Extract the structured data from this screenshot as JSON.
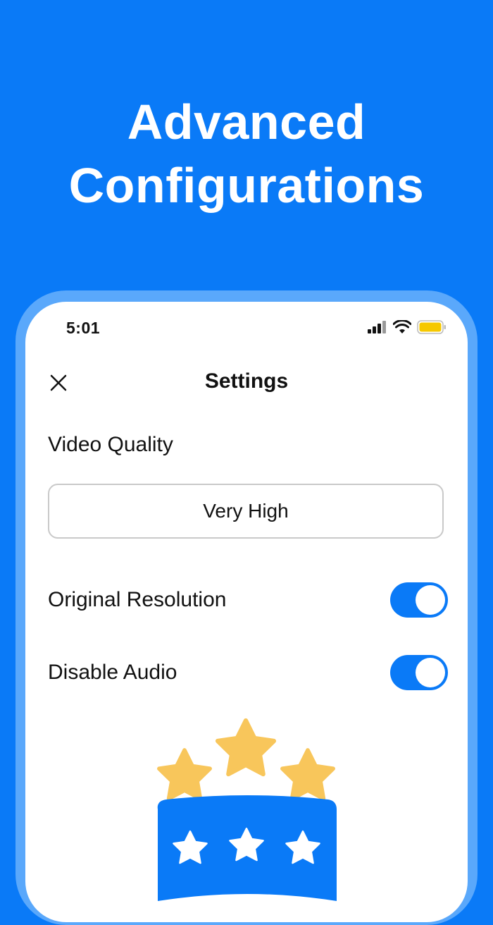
{
  "headline": {
    "line1": "Advanced",
    "line2": "Configurations"
  },
  "status_bar": {
    "time": "5:01",
    "icons": [
      "cellular-signal-icon",
      "wifi-icon",
      "battery-icon"
    ],
    "battery_color": "#f6c800"
  },
  "nav": {
    "close_icon": "close-icon",
    "title": "Settings"
  },
  "video_quality": {
    "label": "Video Quality",
    "selected": "Very High"
  },
  "settings": [
    {
      "label": "Original Resolution",
      "enabled": true
    },
    {
      "label": "Disable Audio",
      "enabled": true
    }
  ],
  "colors": {
    "background": "#0a7af7",
    "frame": "#5aa8fb",
    "toggle_on": "#0a7af7",
    "star_gold": "#f8c65b"
  },
  "rating_illustration": {
    "icon": "five-star-rating-icon"
  }
}
